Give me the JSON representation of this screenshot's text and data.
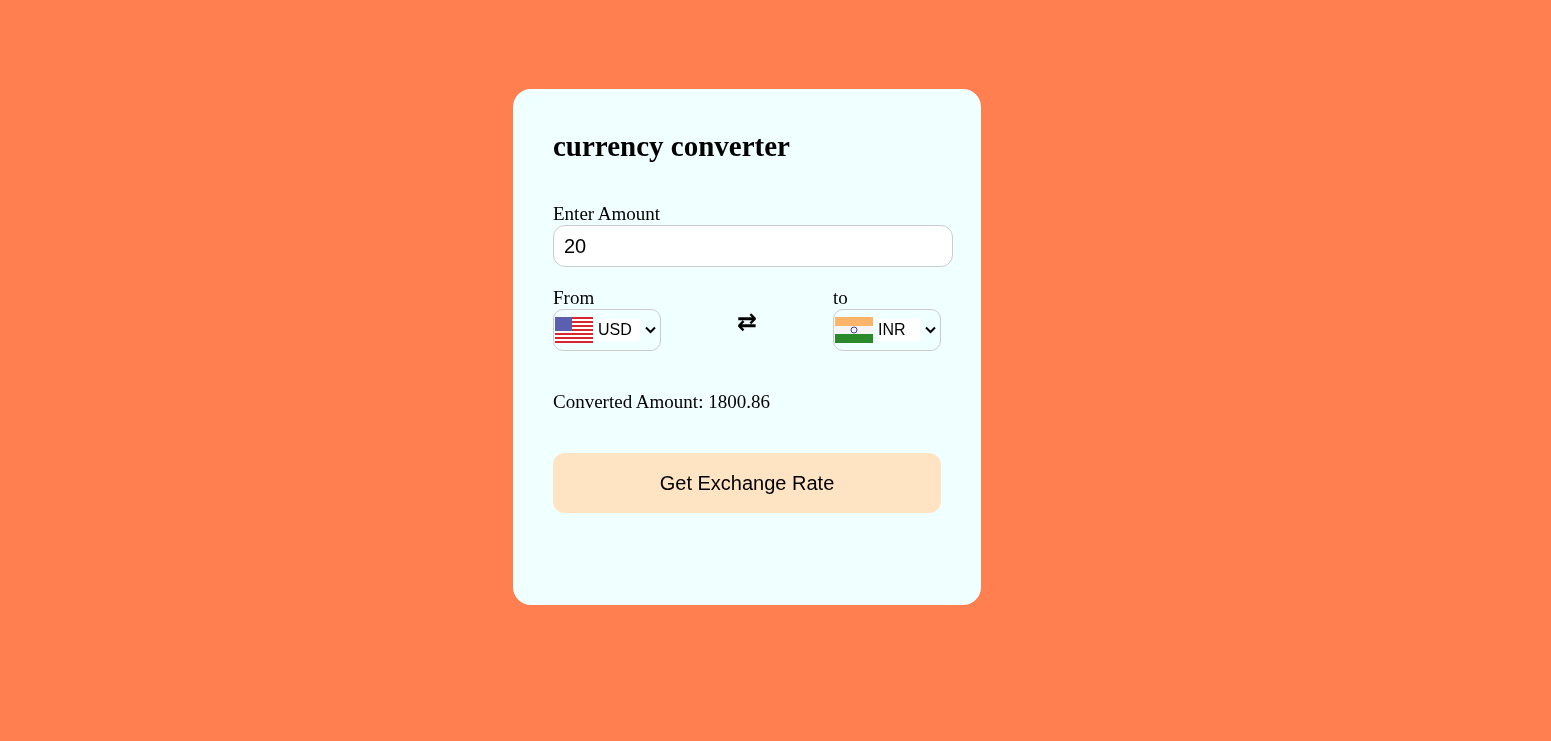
{
  "title": "currency converter",
  "amount": {
    "label": "Enter Amount",
    "value": "20"
  },
  "currencies": [
    {
      "label": "From",
      "code": "USD"
    },
    {
      "label": "to",
      "code": "INR"
    }
  ],
  "swap": "⇄",
  "result": "Converted Amount: 1800.86",
  "button": "Get Exchange Rate"
}
